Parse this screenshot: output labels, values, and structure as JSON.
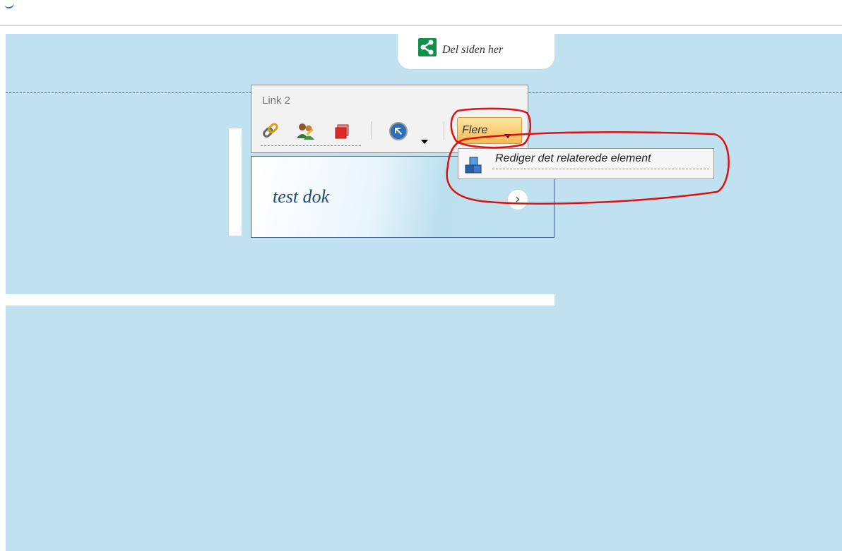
{
  "share": {
    "label": "Del siden her",
    "icon": "share-icon"
  },
  "toolbar": {
    "title": "Link 2",
    "icons": [
      "link-icon",
      "users-icon",
      "red-cube-icon",
      "blue-arrow-circle-icon"
    ],
    "more_label": "Flere"
  },
  "dropdown": {
    "item_label": "Rediger det relaterede element",
    "item_icon": "blue-blocks-icon"
  },
  "card": {
    "title": "test dok",
    "arrow_icon": "chevron-right-icon"
  },
  "colors": {
    "background": "#c0e2f0",
    "share_green": "#11904a",
    "annotation_red": "#e01010",
    "more_button": "#f6b955",
    "card_title": "#1f4a72"
  }
}
